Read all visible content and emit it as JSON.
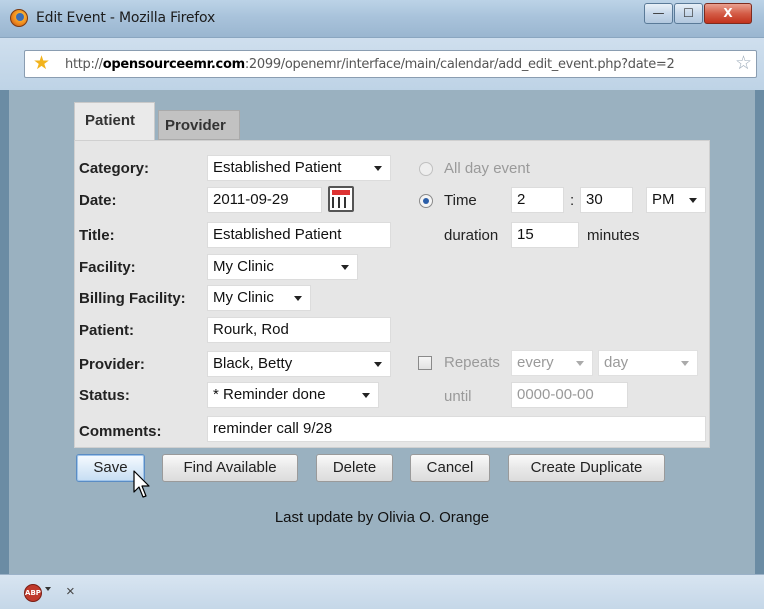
{
  "window": {
    "title": "Edit Event - Mozilla Firefox",
    "min_symbol": "—",
    "max_symbol": "☐",
    "close_symbol": "X"
  },
  "address": {
    "prefix": "http://",
    "host": "opensourceemr.com",
    "rest": ":2099/openemr/interface/main/calendar/add_edit_event.php?date=2"
  },
  "tabs": {
    "patient": "Patient",
    "provider": "Provider"
  },
  "form": {
    "category": {
      "label": "Category:",
      "value": "Established Patient"
    },
    "date": {
      "label": "Date:",
      "value": "2011-09-29"
    },
    "title": {
      "label": "Title:",
      "value": "Established Patient"
    },
    "facility": {
      "label": "Facility:",
      "value": "My Clinic"
    },
    "billing_facility": {
      "label": "Billing Facility:",
      "value": "My Clinic"
    },
    "patient": {
      "label": "Patient:",
      "value": "Rourk, Rod"
    },
    "provider": {
      "label": "Provider:",
      "value": "Black, Betty"
    },
    "status": {
      "label": "Status:",
      "value": "* Reminder done"
    },
    "comments": {
      "label": "Comments:",
      "value": "reminder call 9/28"
    },
    "all_day": {
      "label": "All day event"
    },
    "time": {
      "label": "Time",
      "hour": "2",
      "sep": ":",
      "minute": "30",
      "ampm": "PM"
    },
    "duration": {
      "label": "duration",
      "value": "15",
      "unit": "minutes"
    },
    "repeats": {
      "label": "Repeats",
      "every": "every",
      "day": "day"
    },
    "until": {
      "label": "until",
      "value": "0000-00-00"
    }
  },
  "buttons": {
    "save": "Save",
    "find_available": "Find Available",
    "delete": "Delete",
    "cancel": "Cancel",
    "create_duplicate": "Create Duplicate"
  },
  "last_update": "Last update by Olivia O. Orange",
  "statusbar": {
    "abp": "ABP",
    "close": "×"
  },
  "icons": {
    "browser": "firefox-icon",
    "bookmark": "star-icon",
    "calendar": "calendar-icon",
    "adblock": "adblock-icon",
    "cursor": "mouse-pointer-icon"
  }
}
